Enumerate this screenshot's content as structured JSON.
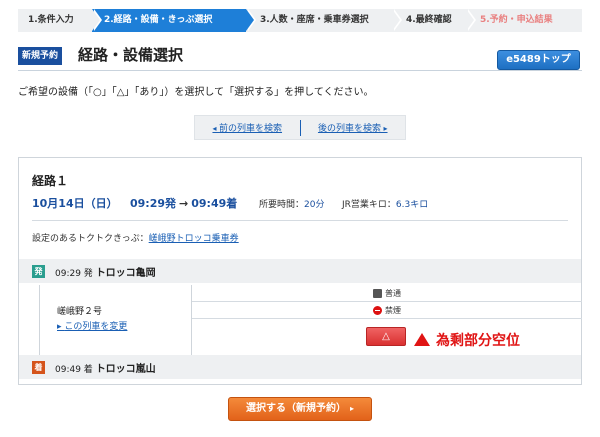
{
  "steps": [
    {
      "label": "1.条件入力"
    },
    {
      "label": "2.経路・設備・きっぷ選択"
    },
    {
      "label": "3.人数・座席・乗車券選択"
    },
    {
      "label": "4.最終確認"
    },
    {
      "label": "5.予約・申込結果"
    }
  ],
  "header": {
    "badge": "新規予約",
    "title": "経路・設備選択",
    "top_button": "e5489トップ"
  },
  "instruction": "ご希望の設備（「○」「△」「あり」）を選択して「選択する」を押してください。",
  "nav": {
    "prev": "前の列車を検索",
    "next": "後の列車を検索"
  },
  "route": {
    "title": "経路１",
    "date": "10月14日（日）",
    "dep_time": "09:29発",
    "arrow": "→",
    "arr_time": "09:49着",
    "duration_label": "所要時間：",
    "duration_value": "20分",
    "distance_label": "JR営業キロ：",
    "distance_value": "6.3キロ",
    "ticket_label": "設定のあるトクトクきっぷ：",
    "ticket_link": "嵯峨野トロッコ乗車券",
    "departure": {
      "badge": "発",
      "time": "09:29 発",
      "station": "トロッコ亀岡"
    },
    "train": {
      "name": "嵯峨野２号",
      "change_link": "この列車を変更"
    },
    "classes": [
      {
        "label": "普通",
        "icon": "seat-icon"
      },
      {
        "label": "禁煙",
        "icon": "no-smoking-icon"
      }
    ],
    "availability": "△",
    "arrival": {
      "badge": "着",
      "time": "09:49 着",
      "station": "トロッコ嵐山"
    }
  },
  "annotation": "為剩部分空位",
  "select_button": "選択する（新規予約）",
  "colors": {
    "accent_blue": "#1e7fd8",
    "alert_red": "#e01414",
    "select_orange": "#e2621a"
  }
}
